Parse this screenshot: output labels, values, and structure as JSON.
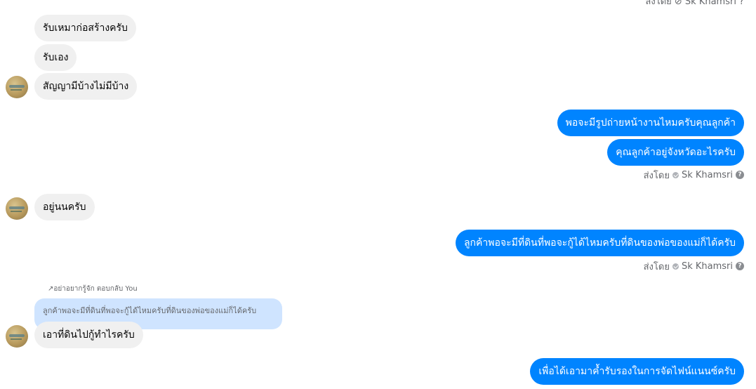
{
  "top_meta": {
    "text": "ส่งโดย ⊘ Sk Khamsri ?"
  },
  "messages": [
    {
      "text": "รับเหมาก่อสร้างครับ"
    },
    {
      "text": "รับเอง"
    },
    {
      "text": "สัญญามีบ้างไม่มีบ้าง"
    },
    {
      "text": "พอจะมีรูปถ่ายหน้างานไหมครับคุณลูกค้า"
    },
    {
      "text": "คุณลูกค้าอยู่จังหวัดอะไรครับ"
    },
    {
      "text": "อยู่นนครับ"
    },
    {
      "text": "ลูกค้าพอจะมีที่ดินที่พอจะกู้ได้ไหมครับที่ดินของพ่อของแม่ก็ได้ครับ"
    },
    {
      "text": "เอาที่ดินไปกู้ทำไรครับ"
    },
    {
      "text": "เพื่อได้เอามาค้ำรับรองในการจัดไฟน์แนนซ์ครับ"
    }
  ],
  "sent_by": {
    "prefix": "ส่งโดย",
    "name": "Sk Khamsri",
    "help": "?"
  },
  "reply": {
    "label": "อย่าอยากรู้จัก ตอบกลับ You",
    "quote": "ลูกค้าพอจะมีที่ดินที่พอจะกู้ได้ไหมครับที่ดินของพ่อของแม่ก็ได้ครับ"
  },
  "colors": {
    "outgoing": "#0084ff",
    "incoming": "#f0f0f0",
    "reply_quote": "#cfe4ff"
  }
}
